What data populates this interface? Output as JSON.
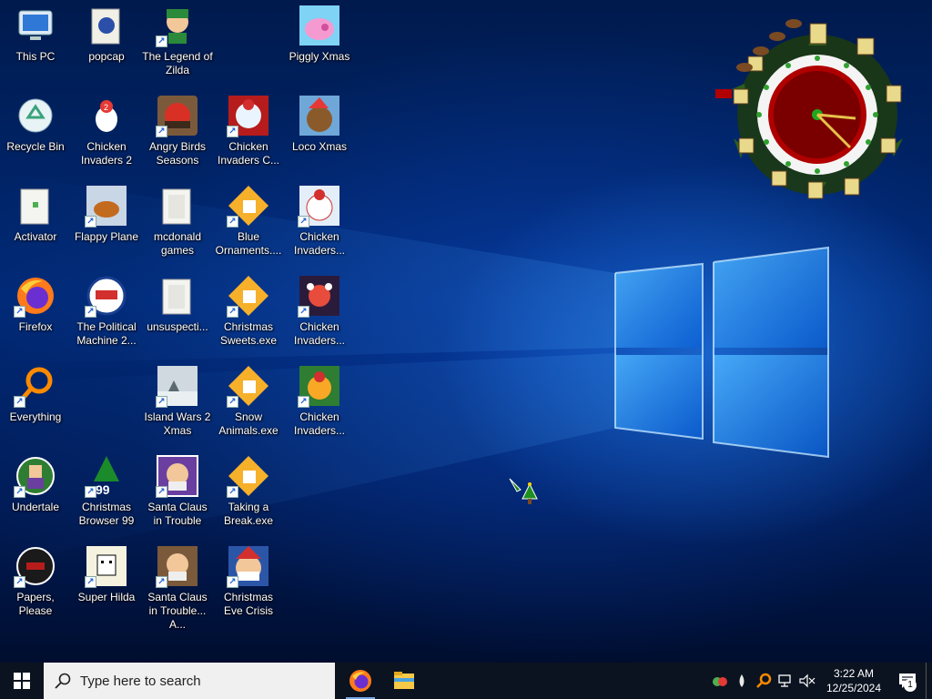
{
  "desktop": {
    "icons": [
      {
        "id": "this-pc",
        "label": "This PC",
        "shortcut": false
      },
      {
        "id": "popcap",
        "label": "popcap",
        "shortcut": false
      },
      {
        "id": "legend-of-zilda",
        "label": "The Legend of Zilda",
        "shortcut": true
      },
      {
        "id": "piggly-xmas",
        "label": "Piggly Xmas",
        "shortcut": false
      },
      {
        "id": "recycle-bin",
        "label": "Recycle Bin",
        "shortcut": false
      },
      {
        "id": "chicken-invaders-2",
        "label": "Chicken Invaders 2",
        "shortcut": false
      },
      {
        "id": "angry-birds-seasons",
        "label": "Angry Birds Seasons",
        "shortcut": true
      },
      {
        "id": "chicken-invaders-c",
        "label": "Chicken Invaders C...",
        "shortcut": true
      },
      {
        "id": "loco-xmas",
        "label": "Loco Xmas",
        "shortcut": false
      },
      {
        "id": "activator",
        "label": "Activator",
        "shortcut": false
      },
      {
        "id": "flappy-plane",
        "label": "Flappy Plane",
        "shortcut": true
      },
      {
        "id": "mcdonald-games",
        "label": "mcdonald games",
        "shortcut": false
      },
      {
        "id": "blue-ornaments",
        "label": "Blue Ornaments....",
        "shortcut": true
      },
      {
        "id": "chicken-invaders-r3",
        "label": "Chicken Invaders...",
        "shortcut": true
      },
      {
        "id": "firefox",
        "label": "Firefox",
        "shortcut": true
      },
      {
        "id": "political-machine",
        "label": "The Political Machine 2...",
        "shortcut": true
      },
      {
        "id": "unsuspecting",
        "label": "unsuspecti...",
        "shortcut": false
      },
      {
        "id": "christmas-sweets",
        "label": "Christmas Sweets.exe",
        "shortcut": true
      },
      {
        "id": "chicken-invaders-r4",
        "label": "Chicken Invaders...",
        "shortcut": true
      },
      {
        "id": "everything",
        "label": "Everything",
        "shortcut": true
      },
      {
        "id": "island-wars-2",
        "label": "Island Wars 2 Xmas",
        "shortcut": true
      },
      {
        "id": "snow-animals",
        "label": "Snow Animals.exe",
        "shortcut": true
      },
      {
        "id": "chicken-invaders-r5",
        "label": "Chicken Invaders...",
        "shortcut": true
      },
      {
        "id": "undertale",
        "label": "Undertale",
        "shortcut": true
      },
      {
        "id": "christmas-browser-99",
        "label": "Christmas Browser 99",
        "shortcut": true
      },
      {
        "id": "santa-claus-trouble",
        "label": "Santa Claus in Trouble",
        "shortcut": true
      },
      {
        "id": "taking-a-break",
        "label": "Taking a Break.exe",
        "shortcut": true
      },
      {
        "id": "papers-please",
        "label": "Papers, Please",
        "shortcut": true
      },
      {
        "id": "super-hilda",
        "label": "Super Hilda",
        "shortcut": true
      },
      {
        "id": "santa-claus-trouble-a",
        "label": "Santa Claus in Trouble... A...",
        "shortcut": true
      },
      {
        "id": "christmas-eve-crisis",
        "label": "Christmas Eve Crisis",
        "shortcut": true
      }
    ]
  },
  "taskbar": {
    "search_placeholder": "Type here to search",
    "pinned": [
      "firefox-icon",
      "file-explorer-icon"
    ],
    "clock_time": "3:22 AM",
    "clock_date": "12/25/2024",
    "notification_count": "1"
  },
  "colors": {
    "taskbar_bg": "#0b1320",
    "wallpaper_accent": "#2b8cff"
  }
}
